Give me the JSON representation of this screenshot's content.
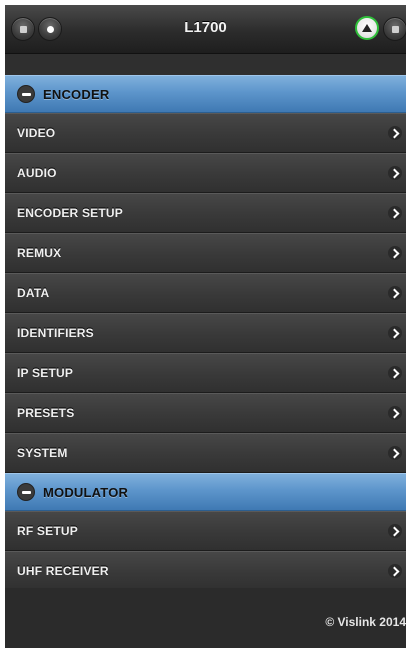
{
  "header": {
    "title": "L1700",
    "left_buttons": [
      {
        "icon": "stop-icon"
      },
      {
        "icon": "dot-icon"
      }
    ],
    "right_buttons": [
      {
        "icon": "up-arrow-icon",
        "accent": "#2fbf3a"
      },
      {
        "icon": "stop-icon"
      }
    ]
  },
  "sections": [
    {
      "label": "ENCODER",
      "icon": "minus-icon",
      "items": [
        {
          "label": "VIDEO"
        },
        {
          "label": "AUDIO"
        },
        {
          "label": "ENCODER SETUP"
        },
        {
          "label": "REMUX"
        },
        {
          "label": "DATA"
        },
        {
          "label": "IDENTIFIERS"
        },
        {
          "label": "IP SETUP"
        },
        {
          "label": "PRESETS"
        },
        {
          "label": "SYSTEM"
        }
      ]
    },
    {
      "label": "MODULATOR",
      "icon": "minus-icon",
      "items": [
        {
          "label": "RF SETUP"
        },
        {
          "label": "UHF RECEIVER"
        }
      ]
    }
  ],
  "footer": {
    "copyright": "© Vislink 2014"
  },
  "colors": {
    "section_bar": "#5d95cb",
    "row_bg": "#3a3a3a",
    "accent_green": "#2fbf3a"
  }
}
